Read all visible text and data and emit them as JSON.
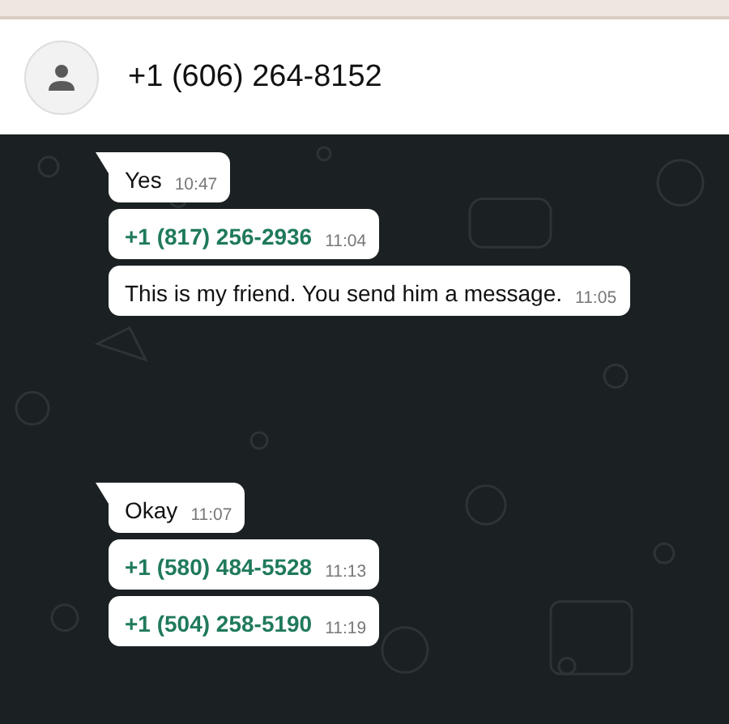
{
  "header": {
    "contact": "+1 (606) 264-8152"
  },
  "groups": [
    {
      "messages": [
        {
          "kind": "text",
          "text": "Yes",
          "time": "10:47"
        },
        {
          "kind": "phone",
          "text": "+1 (817) 256-2936",
          "time": "11:04"
        },
        {
          "kind": "text",
          "text": "This is my friend. You send him a message.",
          "time": "11:05"
        }
      ]
    },
    {
      "messages": [
        {
          "kind": "text",
          "text": "Okay",
          "time": "11:07"
        },
        {
          "kind": "phone",
          "text": "+1 (580) 484-5528",
          "time": "11:13"
        },
        {
          "kind": "phone",
          "text": "+1 (504) 258-5190",
          "time": "11:19"
        }
      ]
    }
  ]
}
